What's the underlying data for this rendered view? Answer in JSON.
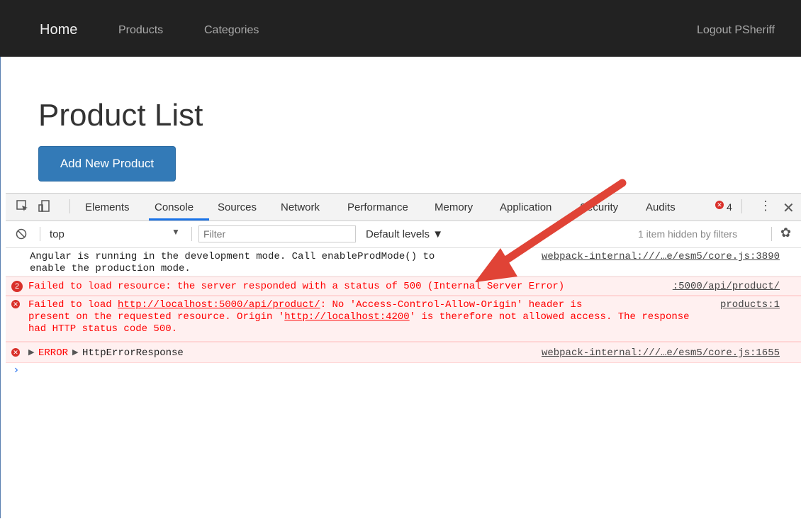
{
  "navbar": {
    "brand": "Home",
    "links": [
      "Products",
      "Categories"
    ],
    "logout": "Logout PSheriff"
  },
  "page": {
    "title": "Product List",
    "add_button": "Add New Product"
  },
  "devtools": {
    "tabs": [
      "Elements",
      "Console",
      "Sources",
      "Network",
      "Performance",
      "Memory",
      "Application",
      "Security",
      "Audits"
    ],
    "active_tab": "Console",
    "error_count": "4",
    "context": "top",
    "filter_placeholder": "Filter",
    "levels": "Default levels ▼",
    "hidden_info": "1 item hidden by filters"
  },
  "console": {
    "info_line1": "Angular is running in the development mode. Call enableProdMode() to",
    "info_line2": "enable the production mode.",
    "info_src": "webpack-internal:///…e/esm5/core.js:3890",
    "err1_count": "2",
    "err1_text": "Failed to load resource: the server responded with a status of 500 (Internal Server Error)",
    "err1_src": ":5000/api/product/",
    "err2_prefix": "Failed to load ",
    "err2_url": "http://localhost:5000/api/product/",
    "err2_suffix": ": No 'Access-Control-Allow-Origin' header is",
    "err2_line2a": "present on the requested resource. Origin '",
    "err2_origin": "http://localhost:4200",
    "err2_line2b": "' is therefore not allowed access. The response",
    "err2_line3": "had HTTP status code 500.",
    "err2_src": "products:1",
    "err3_a": "ERROR",
    "err3_b": "HttpErrorResponse",
    "err3_src": "webpack-internal:///…e/esm5/core.js:1655"
  },
  "colors": {
    "navbar_bg": "#222222",
    "button_bg": "#337ab7",
    "error_red": "#d9302a",
    "arrow_red": "#e04336"
  }
}
